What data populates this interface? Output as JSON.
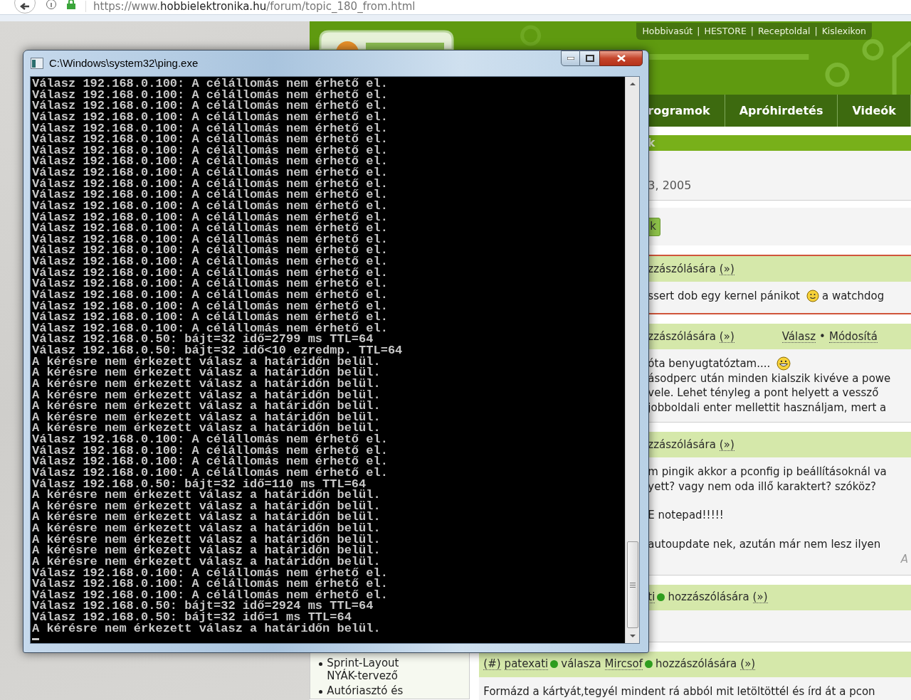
{
  "browser": {
    "url": {
      "scheme": "https://www.",
      "host": "hobbielektronika.hu",
      "path": "/forum/topic_180_from.html"
    }
  },
  "site": {
    "header_links": {
      "items": [
        "Hobbivasút",
        "HESTORE",
        "Receptoldal",
        "Kislexikon"
      ],
      "separator": "|"
    },
    "nav": [
      "rogramok",
      "Apróhirdetés",
      "Videók"
    ],
    "section_bar": "k",
    "date": "3, 2005",
    "button": "k",
    "sidebar": [
      "Sprint-Layout NYÁK-tervező",
      "Autóriasztó és"
    ],
    "posts": [
      {
        "highlighted": true,
        "header": [
          {
            "kind": "text",
            "text": "zzászólására"
          },
          {
            "kind": "link",
            "text": "(»)"
          }
        ],
        "paragraphs": [
          [
            [
              {
                "kind": "text",
                "text": "ssert dob egy kernel pánikot"
              },
              {
                "kind": "smile"
              },
              {
                "kind": "text",
                "text": "a watchdog"
              }
            ]
          ]
        ]
      },
      {
        "highlighted": false,
        "header": [
          {
            "kind": "text",
            "text": "zzászólására"
          },
          {
            "kind": "link",
            "text": "(»)"
          }
        ],
        "actions": [
          {
            "kind": "link",
            "text": "Válasz"
          },
          {
            "kind": "text",
            "text": "•"
          },
          {
            "kind": "link",
            "text": "Módosítá"
          }
        ],
        "paragraphs": [
          [
            [
              {
                "kind": "text",
                "text": "óta benyugtatóztam...."
              },
              {
                "kind": "grin"
              }
            ],
            [
              {
                "kind": "text",
                "text": "ásodperc után minden kialszik kivéve a powe"
              }
            ],
            [
              {
                "kind": "text",
                "text": "vele. Lehet tényleg a pont helyett a vessző"
              }
            ],
            [
              {
                "kind": "text",
                "text": "jobboldali enter mellettit használjam, mert a"
              }
            ]
          ]
        ]
      },
      {
        "highlighted": false,
        "header": [
          {
            "kind": "text",
            "text": "zzászólására"
          },
          {
            "kind": "link",
            "text": "(»)"
          }
        ],
        "paragraphs": [
          [
            [
              {
                "kind": "text",
                "text": "m pingik akkor a pconfig ip beállításoknál va"
              }
            ],
            [
              {
                "kind": "text",
                "text": "yett? vagy nem oda illő karaktert? szóköz?"
              }
            ]
          ],
          [
            [
              {
                "kind": "text",
                "text": "E notepad!!!!!"
              }
            ]
          ],
          [
            [
              {
                "kind": "text",
                "text": "autoupdate nek, azután már nem lesz ilyen"
              }
            ]
          ]
        ],
        "note": "A"
      },
      {
        "highlighted": false,
        "header": [
          {
            "kind": "user",
            "text": "ti",
            "color": "#2f9e1f"
          },
          {
            "kind": "text",
            "text": "hozzászólására"
          },
          {
            "kind": "link",
            "text": "(»)"
          }
        ]
      },
      {
        "highlighted": false,
        "header": [
          {
            "kind": "link",
            "text": "(#)"
          },
          {
            "kind": "user",
            "text": "patexati",
            "color": "#2f9e1f"
          },
          {
            "kind": "text",
            "text": "válasza"
          },
          {
            "kind": "user",
            "text": "Mircsof",
            "color": "#2f9e1f"
          },
          {
            "kind": "text",
            "text": "hozzászólására"
          },
          {
            "kind": "link",
            "text": "(»)"
          }
        ],
        "paragraphs": [
          [
            [
              {
                "kind": "text",
                "text": "Formázd a kártyát,tegyél mindent rá abból mit letöltöttél és írd át a pcon"
              }
            ]
          ]
        ]
      }
    ]
  },
  "console": {
    "title": "C:\\Windows\\system32\\ping.exe",
    "lines": [
      "Válasz 192.168.0.100: A célállomás nem érhető el.",
      "Válasz 192.168.0.100: A célállomás nem érhető el.",
      "Válasz 192.168.0.100: A célállomás nem érhető el.",
      "Válasz 192.168.0.100: A célállomás nem érhető el.",
      "Válasz 192.168.0.100: A célállomás nem érhető el.",
      "Válasz 192.168.0.100: A célállomás nem érhető el.",
      "Válasz 192.168.0.100: A célállomás nem érhető el.",
      "Válasz 192.168.0.100: A célállomás nem érhető el.",
      "Válasz 192.168.0.100: A célállomás nem érhető el.",
      "Válasz 192.168.0.100: A célállomás nem érhető el.",
      "Válasz 192.168.0.100: A célállomás nem érhető el.",
      "Válasz 192.168.0.100: A célállomás nem érhető el.",
      "Válasz 192.168.0.100: A célállomás nem érhető el.",
      "Válasz 192.168.0.100: A célállomás nem érhető el.",
      "Válasz 192.168.0.100: A célállomás nem érhető el.",
      "Válasz 192.168.0.100: A célállomás nem érhető el.",
      "Válasz 192.168.0.100: A célállomás nem érhető el.",
      "Válasz 192.168.0.100: A célállomás nem érhető el.",
      "Válasz 192.168.0.100: A célállomás nem érhető el.",
      "Válasz 192.168.0.100: A célállomás nem érhető el.",
      "Válasz 192.168.0.100: A célállomás nem érhető el.",
      "Válasz 192.168.0.100: A célállomás nem érhető el.",
      "Válasz 192.168.0.100: A célállomás nem érhető el.",
      "Válasz 192.168.0.50: bájt=32 idő=2799 ms TTL=64",
      "Válasz 192.168.0.50: bájt=32 idő<10 ezredmp. TTL=64",
      "A kérésre nem érkezett válasz a határidőn belül.",
      "A kérésre nem érkezett válasz a határidőn belül.",
      "A kérésre nem érkezett válasz a határidőn belül.",
      "A kérésre nem érkezett válasz a határidőn belül.",
      "A kérésre nem érkezett válasz a határidőn belül.",
      "A kérésre nem érkezett válasz a határidőn belül.",
      "A kérésre nem érkezett válasz a határidőn belül.",
      "Válasz 192.168.0.100: A célállomás nem érhető el.",
      "Válasz 192.168.0.100: A célállomás nem érhető el.",
      "Válasz 192.168.0.100: A célállomás nem érhető el.",
      "Válasz 192.168.0.100: A célállomás nem érhető el.",
      "Válasz 192.168.0.50: bájt=32 idő=110 ms TTL=64",
      "A kérésre nem érkezett válasz a határidőn belül.",
      "A kérésre nem érkezett válasz a határidőn belül.",
      "A kérésre nem érkezett válasz a határidőn belül.",
      "A kérésre nem érkezett válasz a határidőn belül.",
      "A kérésre nem érkezett válasz a határidőn belül.",
      "A kérésre nem érkezett válasz a határidőn belül.",
      "A kérésre nem érkezett válasz a határidőn belül.",
      "Válasz 192.168.0.100: A célállomás nem érhető el.",
      "Válasz 192.168.0.100: A célállomás nem érhető el.",
      "Válasz 192.168.0.100: A célállomás nem érhető el.",
      "Válasz 192.168.0.50: bájt=32 idő=2924 ms TTL=64",
      "Válasz 192.168.0.50: bájt=32 idő=1 ms TTL=64",
      "A kérésre nem érkezett válasz a határidőn belül."
    ]
  }
}
